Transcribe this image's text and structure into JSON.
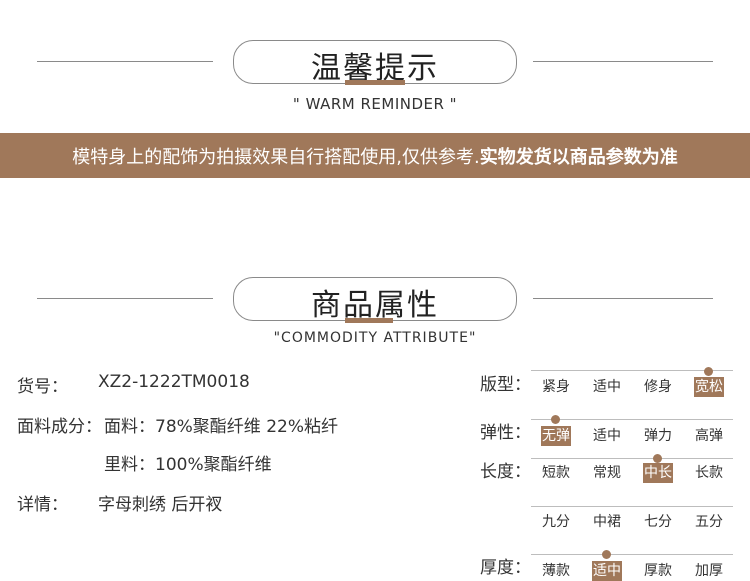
{
  "reminder": {
    "title": "温馨提示",
    "subtitle": "\" WARM REMINDER \"",
    "banner_normal": "模特身上的配饰为拍摄效果自行搭配使用,仅供参考.",
    "banner_bold": "实物发货以商品参数为准"
  },
  "attributes": {
    "title": "商品属性",
    "subtitle": "\"COMMODITY ATTRIBUTE\"",
    "sku_label": "货号：",
    "sku_value": "XZ2-1222TM0018",
    "fabric_label": "面料成分：",
    "fabric_outer": "面料：78%聚酯纤维 22%粘纤",
    "fabric_lining": "里料：100%聚酯纤维",
    "details_label": "详情：",
    "details_value": "字母刺绣 后开衩"
  },
  "specs": [
    {
      "label": "版型：",
      "options": [
        "紧身",
        "适中",
        "修身",
        "宽松"
      ],
      "selected": 3
    },
    {
      "label": "弹性：",
      "options": [
        "无弹",
        "适中",
        "弹力",
        "高弹"
      ],
      "selected": 0
    },
    {
      "label": "长度：",
      "options": [
        "短款",
        "常规",
        "中长",
        "长款"
      ],
      "selected": 2
    },
    {
      "label": "",
      "options": [
        "九分",
        "中裙",
        "七分",
        "五分"
      ],
      "selected": -1
    },
    {
      "label": "厚度：",
      "options": [
        "薄款",
        "适中",
        "厚款",
        "加厚"
      ],
      "selected": 1
    }
  ],
  "colors": {
    "accent": "#a0785a",
    "line": "#8a8a8a"
  }
}
